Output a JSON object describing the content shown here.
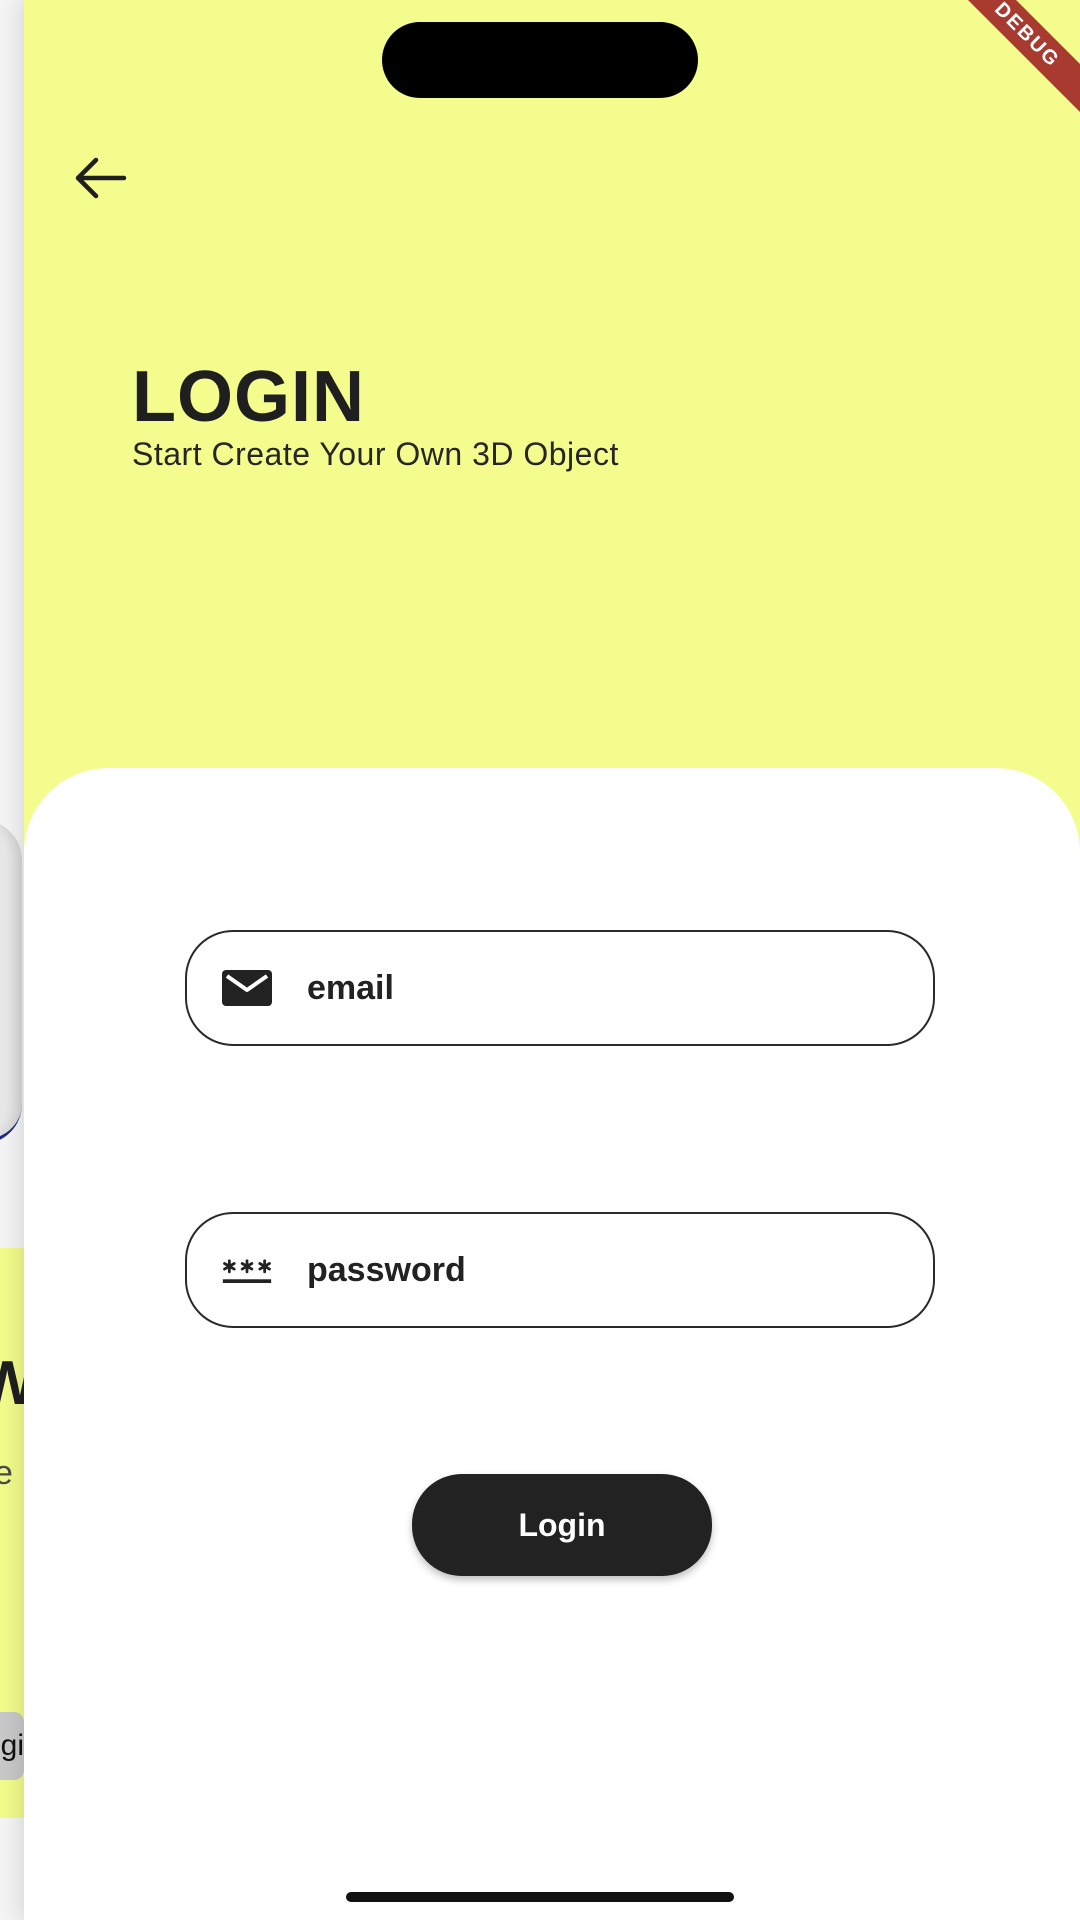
{
  "background_page": {
    "partial_title": "W",
    "partial_subtitle": "e",
    "partial_button": "gi"
  },
  "debug_banner": "DEBUG",
  "header": {
    "back_icon": "arrow-left-icon",
    "title": "LOGIN",
    "subtitle": "Start Create Your Own 3D Object"
  },
  "form": {
    "email": {
      "icon": "mail-icon",
      "placeholder": "email"
    },
    "password": {
      "icon": "password-icon",
      "placeholder": "password"
    },
    "submit_label": "Login"
  },
  "colors": {
    "header_background": "#f3fc8c",
    "sheet_background": "#ffffff",
    "button_background": "#222222",
    "debug_banner": "#a83a2f"
  }
}
